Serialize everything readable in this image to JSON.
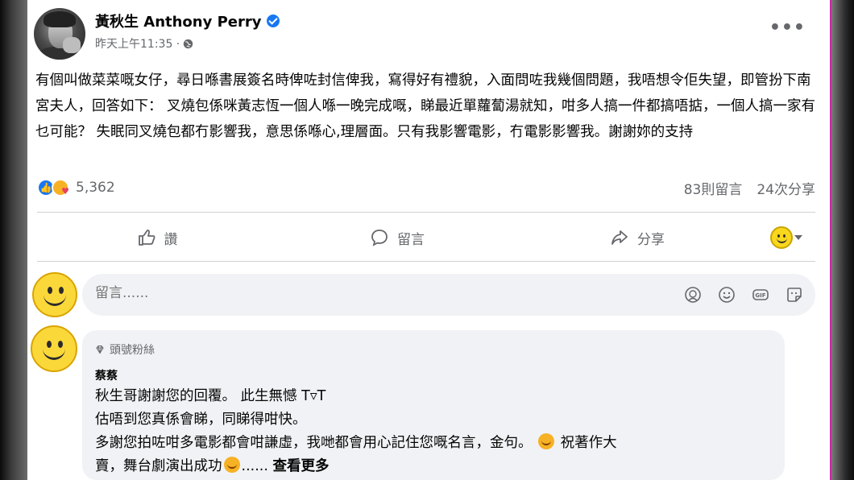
{
  "post": {
    "author": "黃秋生 Anthony Perry",
    "timestamp": "昨天上午11:35 ·",
    "more_label": "•••",
    "text": "有個叫做菜菜嘅女仔，尋日喺書展簽名時俾咗封信俾我，寫得好有禮貌，入面問咗我幾個問題，我唔想令佢失望，即管扮下南宮夫人，回答如下： 叉燒包係咪黃志恆一個人喺一晚完成嘅，睇最近單蘿蔔湯就知，咁多人搞一件都搞唔掂，一個人搞一家有乜可能？ 失眠同叉燒包都冇影響我，意思係喺心,理層面。只有我影響電影，冇電影影響我。謝謝妳的支持"
  },
  "stats": {
    "reaction_count": "5,362",
    "comments": "83則留言",
    "shares": "24次分享"
  },
  "actions": {
    "like": "讚",
    "comment": "留言",
    "share": "分享"
  },
  "composer": {
    "placeholder": "留言......"
  },
  "comment": {
    "badge": "頭號粉絲",
    "author": "蔡蔡",
    "line1": "秋生哥謝謝您的回覆。 此生無憾 T▿T",
    "line2": "估唔到您真係會睇，同睇得咁快。",
    "line3": "多謝您拍咗咁多電影都會咁謙虛，我哋都會用心記住您嘅名言，金句。",
    "line3_tail": "祝著作大",
    "line4": "賣，舞台劇演出成功",
    "line4_tail": "......",
    "see_more": "查看更多"
  },
  "colors": {
    "accent": "#1877f2",
    "secondary_text": "#65676b",
    "bubble_bg": "#f0f2f5"
  }
}
